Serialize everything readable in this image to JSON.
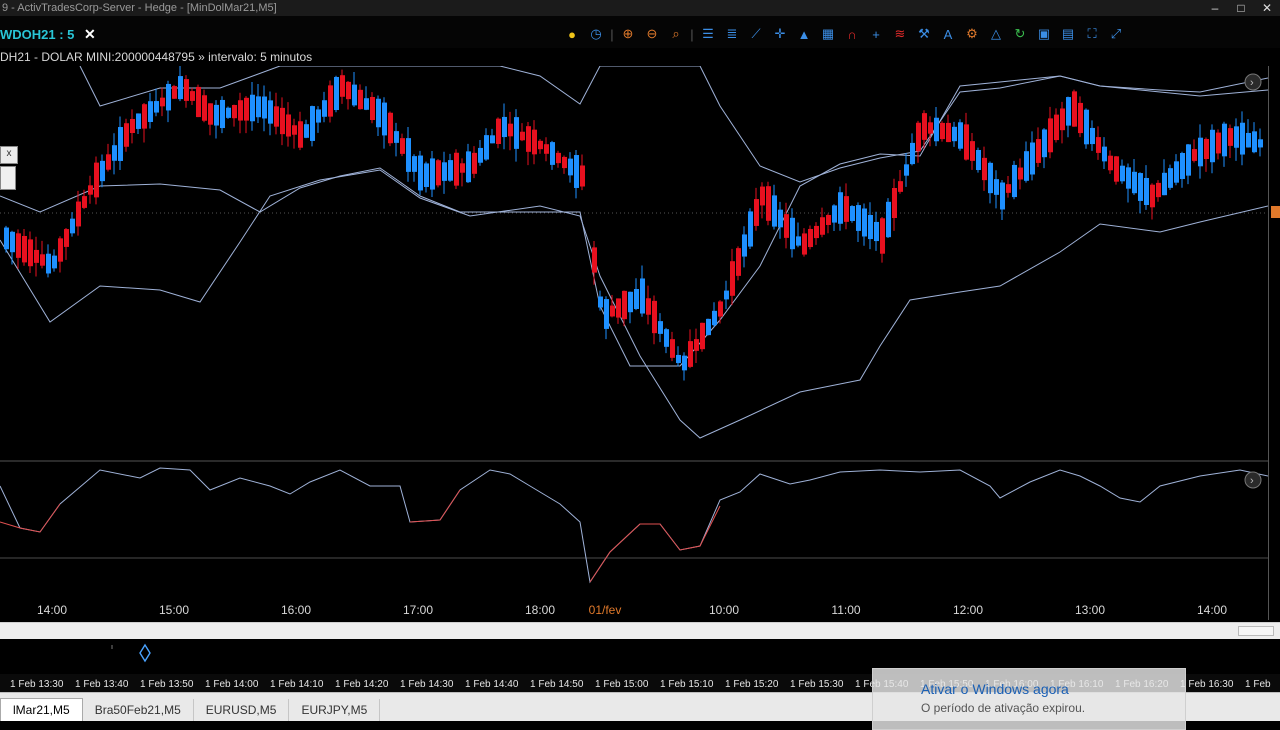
{
  "window": {
    "title": "9 - ActivTradesCorp-Server - Hedge - [MinDolMar21,M5]",
    "controls": [
      "–",
      "□",
      "✕"
    ]
  },
  "symbol_tab": {
    "label": "WDOH21 : 5",
    "close": "✕"
  },
  "toolbar": {
    "icons": [
      "cursor-icon",
      "lightbulb-icon",
      "clock-icon",
      "zoom-in-icon",
      "zoom-out-icon",
      "search-icon",
      "indicators-icon",
      "list-icon",
      "trendline-icon",
      "crosshair-icon",
      "shapes-icon",
      "layout-icon",
      "magnet-icon",
      "add-icon",
      "log-scale-icon",
      "wrench-icon",
      "text-icon",
      "gear-icon",
      "triangle-icon",
      "refresh-icon",
      "save-icon",
      "camera-icon",
      "fit-icon",
      "expand-icon"
    ]
  },
  "info": {
    "text": "DH21 - DOLAR MINI:200000448795 » intervalo: 5 minutos"
  },
  "time_axis": [
    "14:00",
    "15:00",
    "16:00",
    "17:00",
    "18:00",
    "01/fev",
    "10:00",
    "11:00",
    "12:00",
    "13:00",
    "14:00"
  ],
  "nav_times": [
    "1 Feb 13:30",
    "1 Feb 13:40",
    "1 Feb 13:50",
    "1 Feb 14:00",
    "1 Feb 14:10",
    "1 Feb 14:20",
    "1 Feb 14:30",
    "1 Feb 14:40",
    "1 Feb 14:50",
    "1 Feb 15:00",
    "1 Feb 15:10",
    "1 Feb 15:20",
    "1 Feb 15:30",
    "1 Feb 15:40",
    "1 Feb 15:50",
    "1 Feb 16:00",
    "1 Feb 16:10",
    "1 Feb 16:20",
    "1 Feb 16:30",
    "1 Feb"
  ],
  "tabs": [
    "lMar21,M5",
    "Bra50Feb21,M5",
    "EURUSD,M5",
    "EURJPY,M5"
  ],
  "toast": {
    "title": "Ativar o Windows agora",
    "body": "O período de ativação expirou."
  },
  "colors": {
    "up": "#1e90ff",
    "down": "#e8101f",
    "band": "#9fb2d8",
    "osc_low": "#e05050",
    "badge": "#e0792b"
  }
}
